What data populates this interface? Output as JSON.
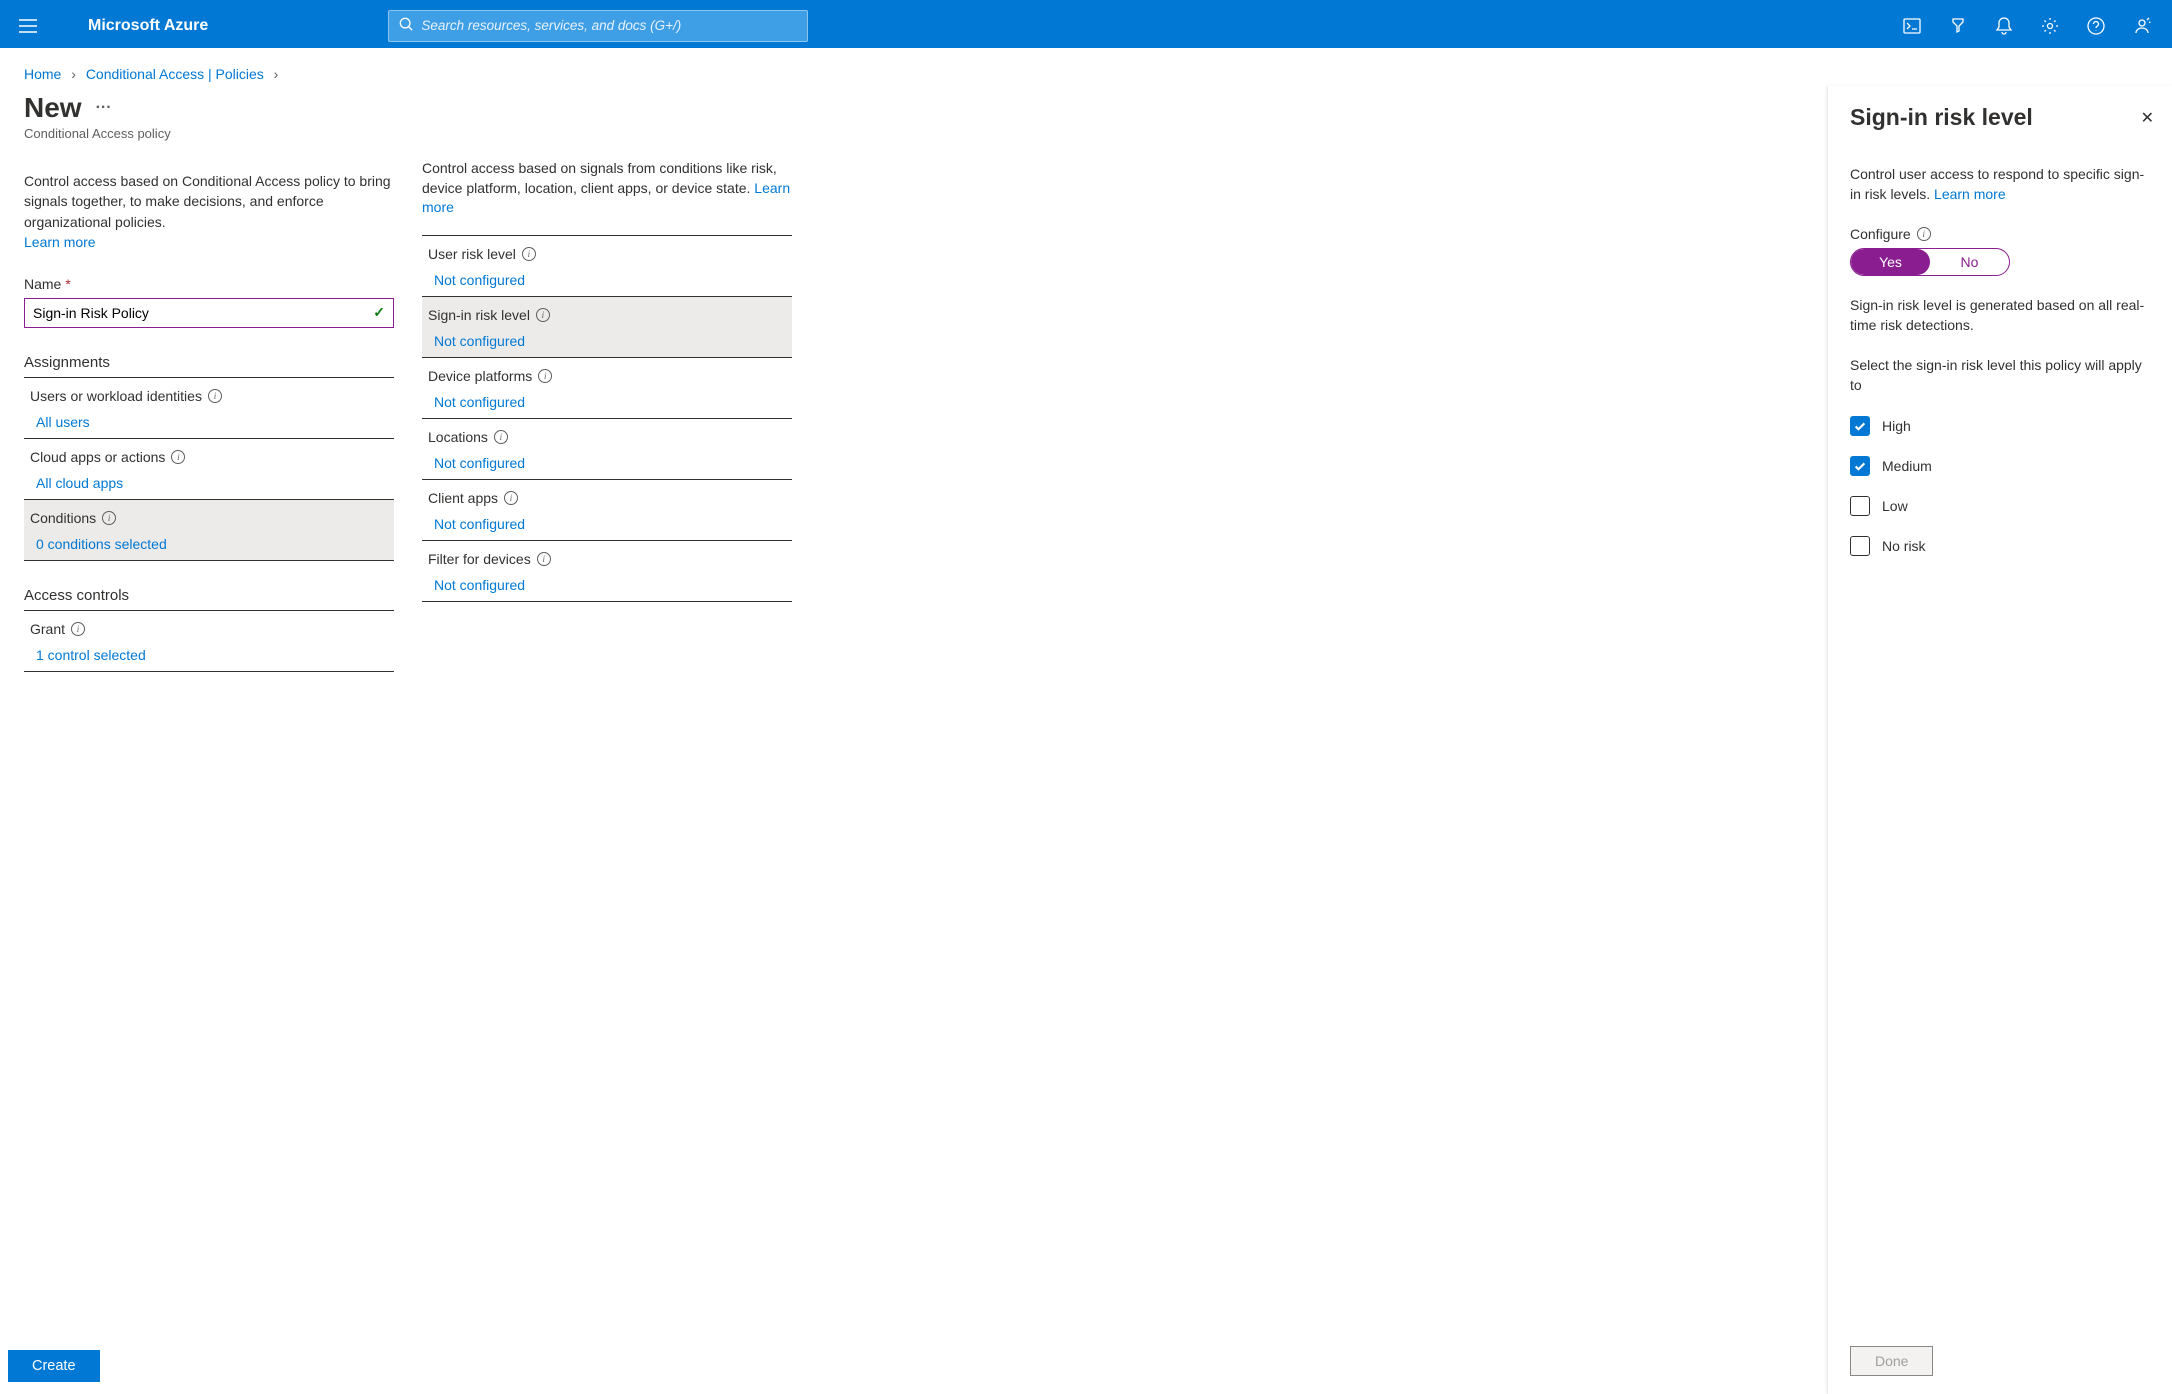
{
  "header": {
    "brand": "Microsoft Azure",
    "search_placeholder": "Search resources, services, and docs (G+/)"
  },
  "breadcrumb": {
    "home": "Home",
    "ca": "Conditional Access | Policies"
  },
  "page": {
    "title": "New",
    "subtitle": "Conditional Access policy",
    "desc": "Control access based on Conditional Access policy to bring signals together, to make decisions, and enforce organizational policies.",
    "learn_more": "Learn more",
    "name_label": "Name",
    "name_value": "Sign-in Risk Policy",
    "assignments_heading": "Assignments",
    "access_controls_heading": "Access controls"
  },
  "col1_settings": [
    {
      "label": "Users or workload identities",
      "value": "All users",
      "selected": false
    },
    {
      "label": "Cloud apps or actions",
      "value": "All cloud apps",
      "selected": false
    },
    {
      "label": "Conditions",
      "value": "0 conditions selected",
      "selected": true
    }
  ],
  "grant_setting": {
    "label": "Grant",
    "value": "1 control selected",
    "selected": false
  },
  "col2": {
    "desc": "Control access based on signals from conditions like risk, device platform, location, client apps, or device state.",
    "learn_more": "Learn more"
  },
  "col2_settings": [
    {
      "label": "User risk level",
      "value": "Not configured",
      "selected": false
    },
    {
      "label": "Sign-in risk level",
      "value": "Not configured",
      "selected": true
    },
    {
      "label": "Device platforms",
      "value": "Not configured",
      "selected": false
    },
    {
      "label": "Locations",
      "value": "Not configured",
      "selected": false
    },
    {
      "label": "Client apps",
      "value": "Not configured",
      "selected": false
    },
    {
      "label": "Filter for devices",
      "value": "Not configured",
      "selected": false
    }
  ],
  "create_label": "Create",
  "panel": {
    "title": "Sign-in risk level",
    "desc": "Control user access to respond to specific sign-in risk levels.",
    "learn_more": "Learn more",
    "configure_label": "Configure",
    "toggle_yes": "Yes",
    "toggle_no": "No",
    "p1": "Sign-in risk level is generated based on all real-time risk detections.",
    "p2": "Select the sign-in risk level this policy will apply to",
    "done_label": "Done"
  },
  "risk_options": [
    {
      "label": "High",
      "checked": true
    },
    {
      "label": "Medium",
      "checked": true
    },
    {
      "label": "Low",
      "checked": false
    },
    {
      "label": "No risk",
      "checked": false
    }
  ]
}
